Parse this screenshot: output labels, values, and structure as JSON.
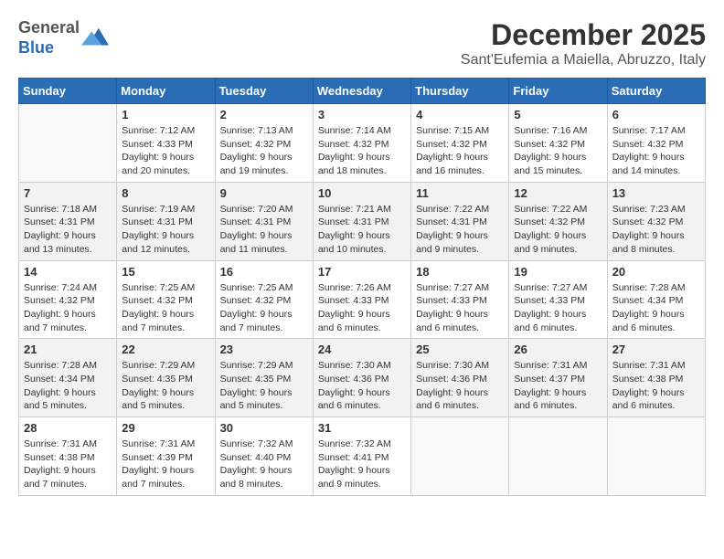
{
  "logo": {
    "general": "General",
    "blue": "Blue"
  },
  "title": "December 2025",
  "subtitle": "Sant'Eufemia a Maiella, Abruzzo, Italy",
  "days_of_week": [
    "Sunday",
    "Monday",
    "Tuesday",
    "Wednesday",
    "Thursday",
    "Friday",
    "Saturday"
  ],
  "weeks": [
    [
      {
        "day": "",
        "info": ""
      },
      {
        "day": "1",
        "info": "Sunrise: 7:12 AM\nSunset: 4:33 PM\nDaylight: 9 hours\nand 20 minutes."
      },
      {
        "day": "2",
        "info": "Sunrise: 7:13 AM\nSunset: 4:32 PM\nDaylight: 9 hours\nand 19 minutes."
      },
      {
        "day": "3",
        "info": "Sunrise: 7:14 AM\nSunset: 4:32 PM\nDaylight: 9 hours\nand 18 minutes."
      },
      {
        "day": "4",
        "info": "Sunrise: 7:15 AM\nSunset: 4:32 PM\nDaylight: 9 hours\nand 16 minutes."
      },
      {
        "day": "5",
        "info": "Sunrise: 7:16 AM\nSunset: 4:32 PM\nDaylight: 9 hours\nand 15 minutes."
      },
      {
        "day": "6",
        "info": "Sunrise: 7:17 AM\nSunset: 4:32 PM\nDaylight: 9 hours\nand 14 minutes."
      }
    ],
    [
      {
        "day": "7",
        "info": "Sunrise: 7:18 AM\nSunset: 4:31 PM\nDaylight: 9 hours\nand 13 minutes."
      },
      {
        "day": "8",
        "info": "Sunrise: 7:19 AM\nSunset: 4:31 PM\nDaylight: 9 hours\nand 12 minutes."
      },
      {
        "day": "9",
        "info": "Sunrise: 7:20 AM\nSunset: 4:31 PM\nDaylight: 9 hours\nand 11 minutes."
      },
      {
        "day": "10",
        "info": "Sunrise: 7:21 AM\nSunset: 4:31 PM\nDaylight: 9 hours\nand 10 minutes."
      },
      {
        "day": "11",
        "info": "Sunrise: 7:22 AM\nSunset: 4:31 PM\nDaylight: 9 hours\nand 9 minutes."
      },
      {
        "day": "12",
        "info": "Sunrise: 7:22 AM\nSunset: 4:32 PM\nDaylight: 9 hours\nand 9 minutes."
      },
      {
        "day": "13",
        "info": "Sunrise: 7:23 AM\nSunset: 4:32 PM\nDaylight: 9 hours\nand 8 minutes."
      }
    ],
    [
      {
        "day": "14",
        "info": "Sunrise: 7:24 AM\nSunset: 4:32 PM\nDaylight: 9 hours\nand 7 minutes."
      },
      {
        "day": "15",
        "info": "Sunrise: 7:25 AM\nSunset: 4:32 PM\nDaylight: 9 hours\nand 7 minutes."
      },
      {
        "day": "16",
        "info": "Sunrise: 7:25 AM\nSunset: 4:32 PM\nDaylight: 9 hours\nand 7 minutes."
      },
      {
        "day": "17",
        "info": "Sunrise: 7:26 AM\nSunset: 4:33 PM\nDaylight: 9 hours\nand 6 minutes."
      },
      {
        "day": "18",
        "info": "Sunrise: 7:27 AM\nSunset: 4:33 PM\nDaylight: 9 hours\nand 6 minutes."
      },
      {
        "day": "19",
        "info": "Sunrise: 7:27 AM\nSunset: 4:33 PM\nDaylight: 9 hours\nand 6 minutes."
      },
      {
        "day": "20",
        "info": "Sunrise: 7:28 AM\nSunset: 4:34 PM\nDaylight: 9 hours\nand 6 minutes."
      }
    ],
    [
      {
        "day": "21",
        "info": "Sunrise: 7:28 AM\nSunset: 4:34 PM\nDaylight: 9 hours\nand 5 minutes."
      },
      {
        "day": "22",
        "info": "Sunrise: 7:29 AM\nSunset: 4:35 PM\nDaylight: 9 hours\nand 5 minutes."
      },
      {
        "day": "23",
        "info": "Sunrise: 7:29 AM\nSunset: 4:35 PM\nDaylight: 9 hours\nand 5 minutes."
      },
      {
        "day": "24",
        "info": "Sunrise: 7:30 AM\nSunset: 4:36 PM\nDaylight: 9 hours\nand 6 minutes."
      },
      {
        "day": "25",
        "info": "Sunrise: 7:30 AM\nSunset: 4:36 PM\nDaylight: 9 hours\nand 6 minutes."
      },
      {
        "day": "26",
        "info": "Sunrise: 7:31 AM\nSunset: 4:37 PM\nDaylight: 9 hours\nand 6 minutes."
      },
      {
        "day": "27",
        "info": "Sunrise: 7:31 AM\nSunset: 4:38 PM\nDaylight: 9 hours\nand 6 minutes."
      }
    ],
    [
      {
        "day": "28",
        "info": "Sunrise: 7:31 AM\nSunset: 4:38 PM\nDaylight: 9 hours\nand 7 minutes."
      },
      {
        "day": "29",
        "info": "Sunrise: 7:31 AM\nSunset: 4:39 PM\nDaylight: 9 hours\nand 7 minutes."
      },
      {
        "day": "30",
        "info": "Sunrise: 7:32 AM\nSunset: 4:40 PM\nDaylight: 9 hours\nand 8 minutes."
      },
      {
        "day": "31",
        "info": "Sunrise: 7:32 AM\nSunset: 4:41 PM\nDaylight: 9 hours\nand 9 minutes."
      },
      {
        "day": "",
        "info": ""
      },
      {
        "day": "",
        "info": ""
      },
      {
        "day": "",
        "info": ""
      }
    ]
  ]
}
